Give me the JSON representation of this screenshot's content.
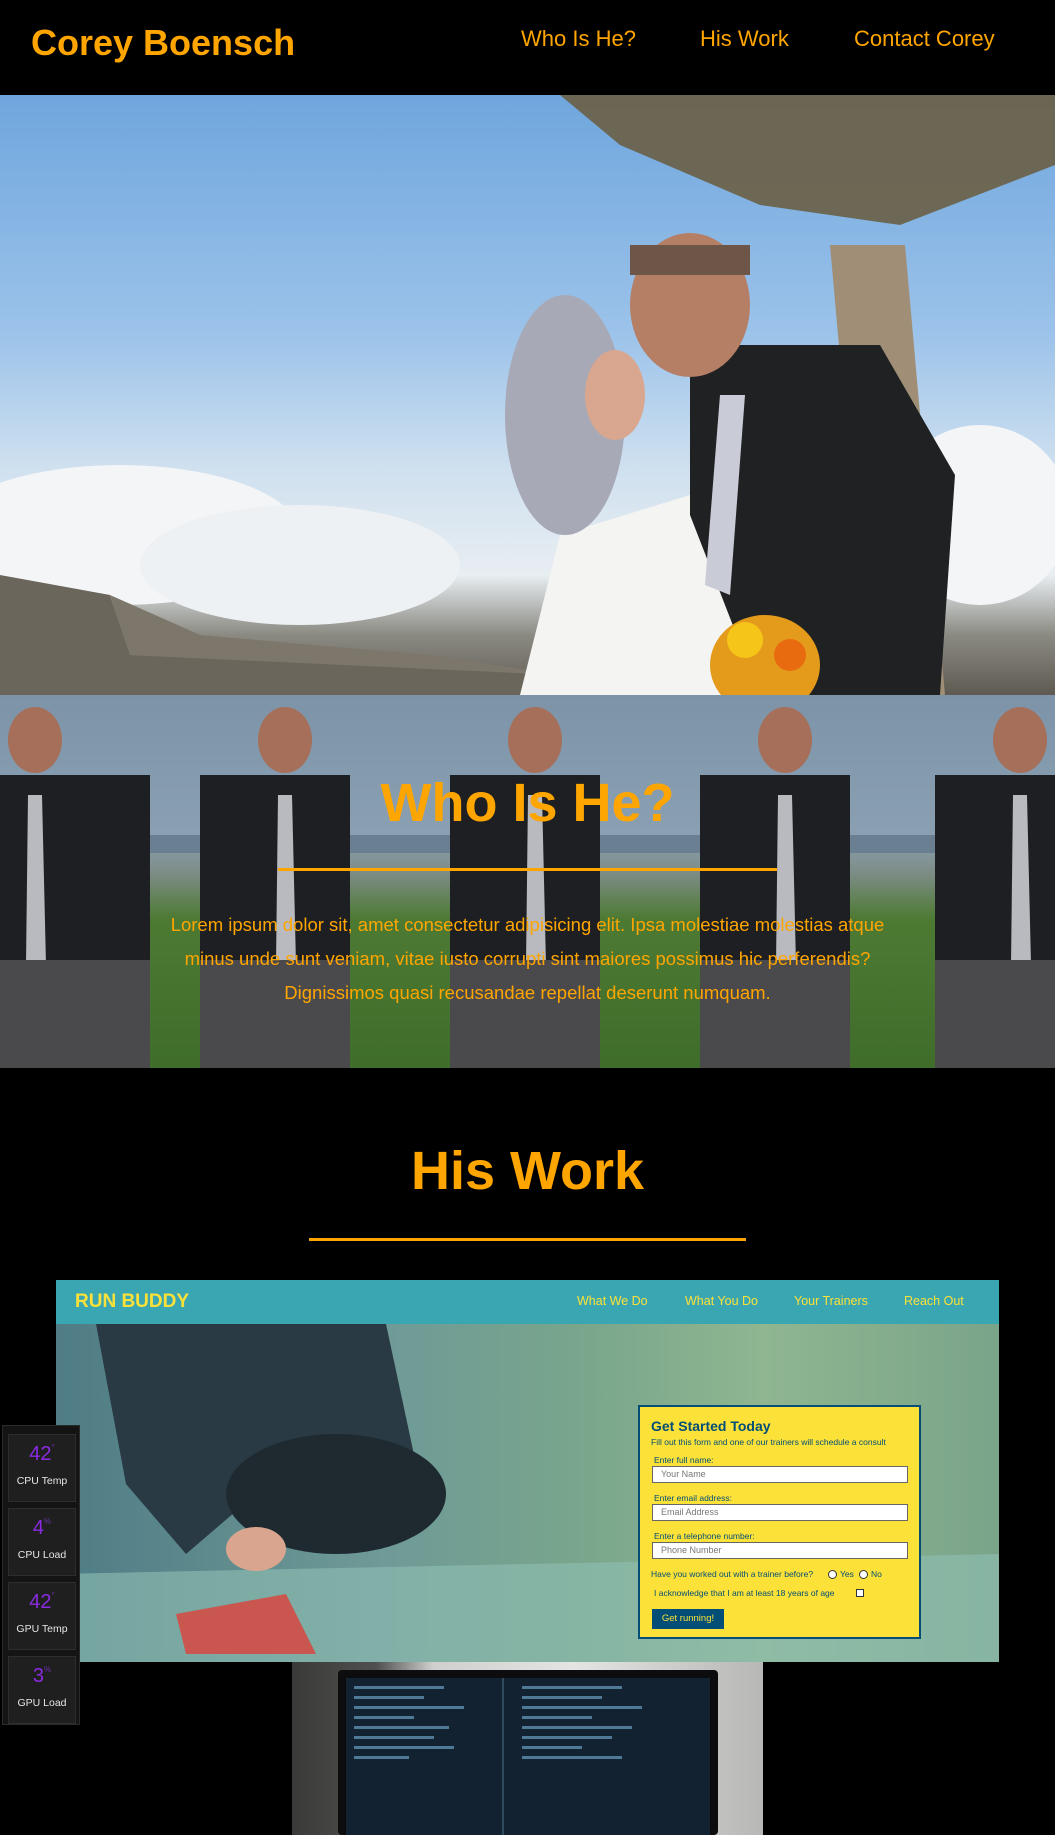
{
  "header": {
    "brand": "Corey Boensch",
    "nav": [
      "Who Is He?",
      "His Work",
      "Contact Corey"
    ]
  },
  "who": {
    "title": "Who Is He?",
    "text": "Lorem ipsum dolor sit, amet consectetur adipisicing elit. Ipsa molestiae molestias atque minus unde sunt veniam, vitae iusto corrupti sint maiores possimus hic perferendis? Dignissimos quasi recusandae repellat deserunt numquam."
  },
  "work": {
    "title": "His Work",
    "project1": {
      "brand": "RUN BUDDY",
      "nav": [
        "What We Do",
        "What You Do",
        "Your Trainers",
        "Reach Out"
      ],
      "form": {
        "title": "Get Started Today",
        "subtitle": "Fill out this form and one of our trainers will schedule a consult",
        "name_label": "Enter full name:",
        "name_placeholder": "Your Name",
        "email_label": "Enter email address:",
        "email_placeholder": "Email Address",
        "phone_label": "Enter a telephone number:",
        "phone_placeholder": "Phone Number",
        "trainer_question": "Have you worked out with a trainer before?",
        "yes": "Yes",
        "no": "No",
        "acknowledge": "I acknowledge that I am at least 18 years of age",
        "button": "Get running!"
      }
    }
  },
  "widget": [
    {
      "value": "42",
      "unit": "°",
      "label": "CPU Temp"
    },
    {
      "value": "4",
      "unit": "%",
      "label": "CPU Load"
    },
    {
      "value": "42",
      "unit": "°",
      "label": "GPU Temp"
    },
    {
      "value": "3",
      "unit": "%",
      "label": "GPU Load"
    }
  ],
  "colors": {
    "background": "#000000",
    "accent": "#ffa500",
    "runbuddy_teal": "#39a6b2",
    "runbuddy_yellow": "#fce138",
    "runbuddy_navy": "#024e76",
    "widget_value": "#8a2be2"
  }
}
